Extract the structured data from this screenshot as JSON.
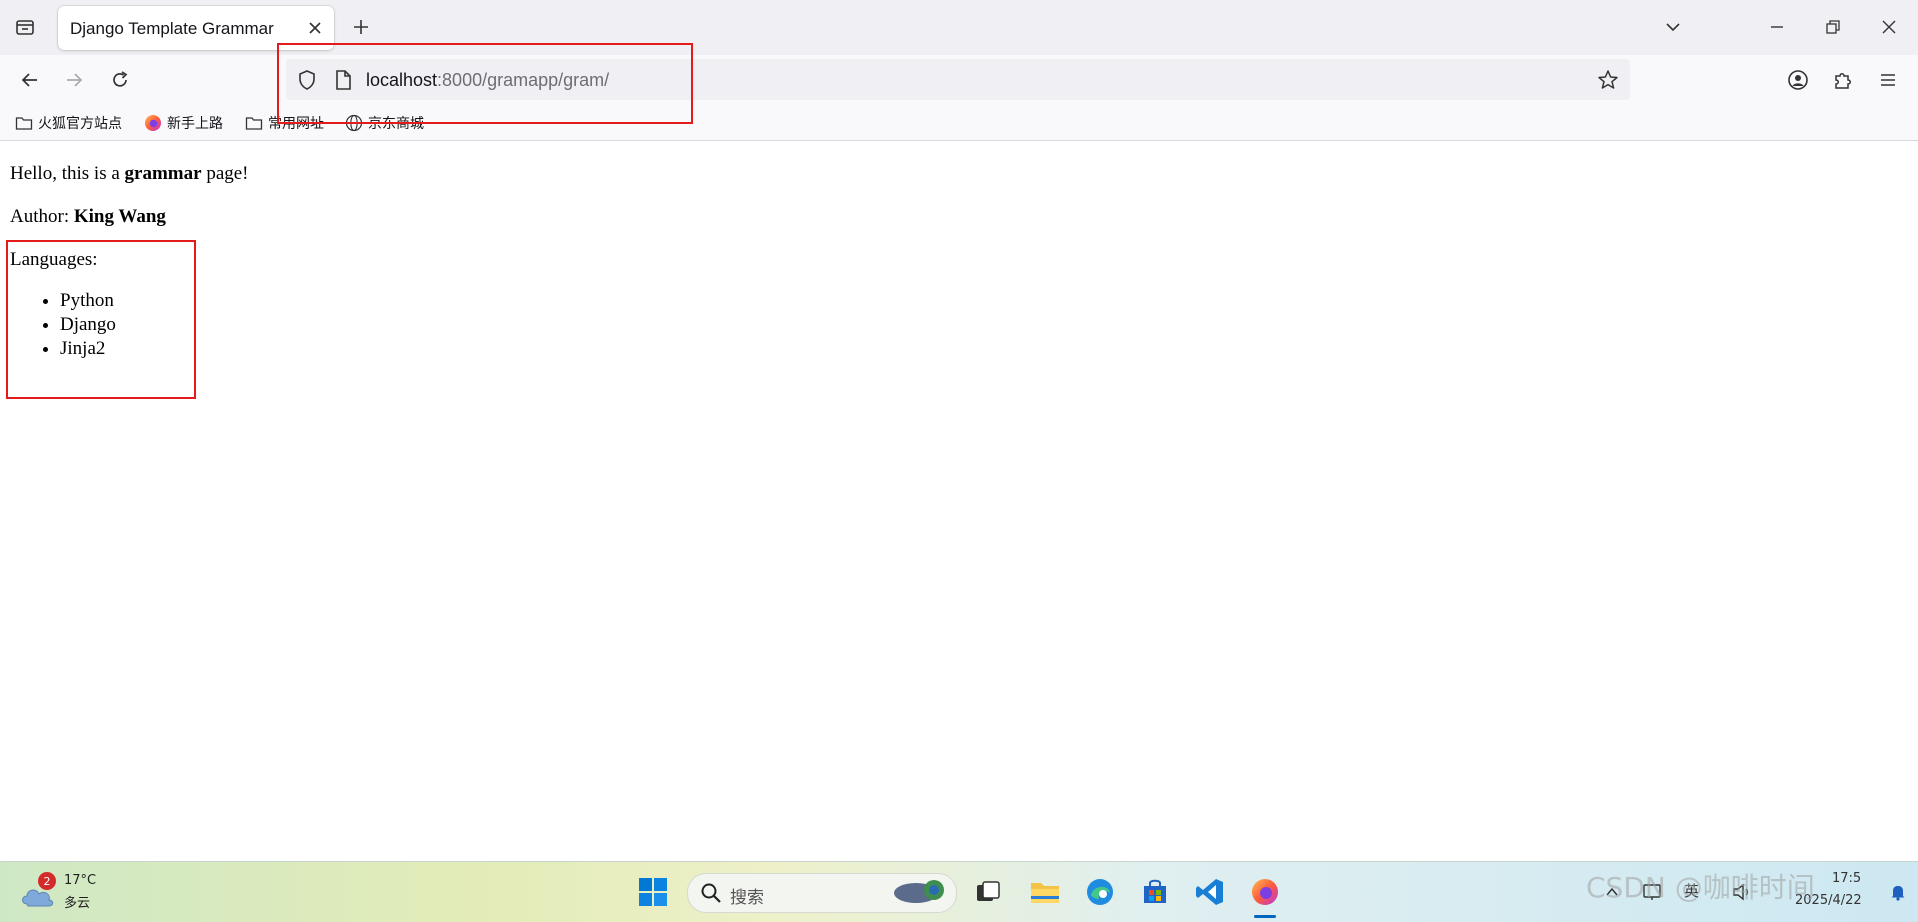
{
  "browser": {
    "tab": {
      "title": "Django Template Grammar"
    },
    "url": {
      "host": "localhost",
      "path": ":8000/gramapp/gram/"
    },
    "bookmarks": [
      {
        "label": "火狐官方站点",
        "icon": "folder-icon"
      },
      {
        "label": "新手上路",
        "icon": "firefox-icon"
      },
      {
        "label": "常用网址",
        "icon": "folder-icon"
      },
      {
        "label": "京东商城",
        "icon": "globe-icon"
      }
    ]
  },
  "page": {
    "greeting": {
      "prefix": "Hello, this is a ",
      "bold": "grammar",
      "suffix": " page!"
    },
    "author": {
      "label": "Author: ",
      "name": "King Wang"
    },
    "languages_label": "Languages:",
    "languages": [
      "Python",
      "Django",
      "Jinja2"
    ]
  },
  "taskbar": {
    "weather": {
      "badge": "2",
      "temp": "17°C",
      "desc": "多云"
    },
    "search_placeholder": "搜索",
    "tray": {
      "ime": "英",
      "time": "17:5",
      "date": "2025/4/22"
    },
    "watermark": "CSDN @咖啡时间"
  },
  "colors": {
    "annotation": "#e31b1b",
    "accent": "#0060df"
  }
}
